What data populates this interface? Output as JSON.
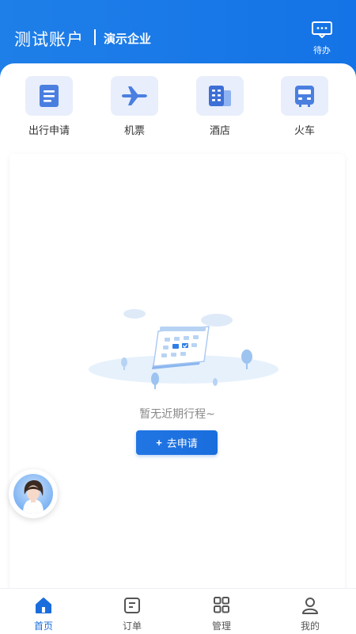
{
  "header": {
    "account_name": "测试账户",
    "company_name": "演示企业",
    "todo_label": "待办",
    "background_color": "#1473e6"
  },
  "quick_actions": [
    {
      "label": "出行申请",
      "icon": "document-icon"
    },
    {
      "label": "机票",
      "icon": "airplane-icon"
    },
    {
      "label": "酒店",
      "icon": "hotel-building-icon"
    },
    {
      "label": "火车",
      "icon": "train-icon"
    }
  ],
  "trips": {
    "empty_text": "暂无近期行程~",
    "apply_button_label": "去申请",
    "apply_button_icon": "+"
  },
  "tabbar": [
    {
      "label": "首页",
      "icon": "home-icon",
      "active": true
    },
    {
      "label": "订单",
      "icon": "order-icon",
      "active": false
    },
    {
      "label": "管理",
      "icon": "grid-icon",
      "active": false
    },
    {
      "label": "我的",
      "icon": "user-icon",
      "active": false
    }
  ],
  "colors": {
    "accent": "#1a6ddc",
    "icon_bg": "#e8eefb",
    "icon_fg": "#4a7fe0"
  }
}
